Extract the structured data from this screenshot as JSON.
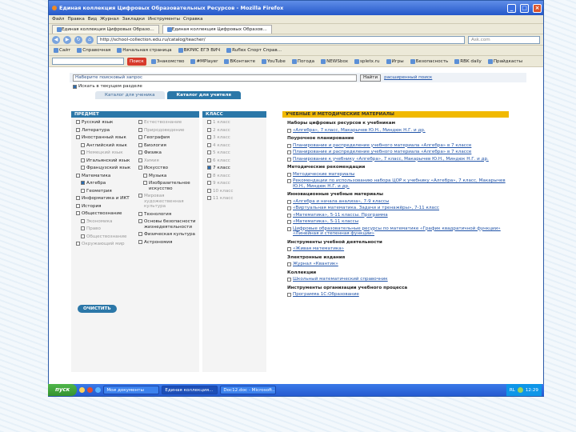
{
  "window": {
    "title": "Единая коллекция Цифровых Образовательных Ресурсов - Mozilla Firefox",
    "controls": [
      "_",
      "□",
      "×"
    ]
  },
  "menu": [
    "Файл",
    "Правка",
    "Вид",
    "Журнал",
    "Закладки",
    "Инструменты",
    "Справка"
  ],
  "tabs": [
    "Единая коллекция Цифровых Образо...",
    "Единая коллекция Цифровых Образов..."
  ],
  "nav": {
    "url": "http://school-collection.edu.ru/catalog/teacher/",
    "search_placeholder": "Ask.com"
  },
  "bookmarks": [
    "Сайт",
    "Справочная",
    "Начальная страница",
    "ВКРИС ЕГЭ ВИЧ",
    "Ruflex Спорт Справ..."
  ],
  "toolbar2": {
    "search_label": "Поиск",
    "items": [
      "Знакомство",
      "#MPlayer",
      "ВКонтакте",
      "YouTube",
      "Погода",
      "NEWSbox",
      "spletx.ru",
      "Игры",
      "Безопасность",
      "RBK daily",
      "Прайдкасты"
    ]
  },
  "page": {
    "search_checkbox": "Искать в текущем разделе",
    "advanced_link": "расширенный поиск",
    "search_button": "Найти",
    "yandex_link": "Наберите поисковый запрос",
    "tabs": [
      "Каталог для ученика",
      "Каталог для учителя"
    ],
    "subject_header": "ПРЕДМЕТ",
    "subjects_col1": [
      {
        "label": "Русский язык",
        "level": 0,
        "checked": false,
        "grey": false
      },
      {
        "label": "Литература",
        "level": 0,
        "checked": false,
        "grey": false
      },
      {
        "label": "Иностранный язык",
        "level": 0,
        "checked": false,
        "grey": false
      },
      {
        "label": "Английский язык",
        "level": 1,
        "checked": false,
        "grey": false
      },
      {
        "label": "Немецкий язык",
        "level": 1,
        "checked": false,
        "grey": true
      },
      {
        "label": "Итальянский язык",
        "level": 1,
        "checked": false,
        "grey": false
      },
      {
        "label": "Французский язык",
        "level": 1,
        "checked": false,
        "grey": false
      },
      {
        "label": "Математика",
        "level": 0,
        "checked": false,
        "grey": false
      },
      {
        "label": "Алгебра",
        "level": 1,
        "checked": true,
        "grey": false
      },
      {
        "label": "Геометрия",
        "level": 1,
        "checked": false,
        "grey": false
      },
      {
        "label": "Информатика и ИКТ",
        "level": 0,
        "checked": false,
        "grey": false
      },
      {
        "label": "История",
        "level": 0,
        "checked": false,
        "grey": false
      },
      {
        "label": "Обществознание",
        "level": 0,
        "checked": false,
        "grey": false
      },
      {
        "label": "Экономика",
        "level": 1,
        "checked": false,
        "grey": true
      },
      {
        "label": "Право",
        "level": 1,
        "checked": false,
        "grey": true
      },
      {
        "label": "Обществознание",
        "level": 1,
        "checked": false,
        "grey": true
      },
      {
        "label": "Окружающий мир",
        "level": 0,
        "checked": false,
        "grey": true
      }
    ],
    "subjects_col2": [
      {
        "label": "Естествознание",
        "level": 0,
        "checked": false,
        "grey": true
      },
      {
        "label": "Природоведение",
        "level": 0,
        "checked": false,
        "grey": true
      },
      {
        "label": "География",
        "level": 0,
        "checked": false,
        "grey": false
      },
      {
        "label": "Биология",
        "level": 0,
        "checked": false,
        "grey": false
      },
      {
        "label": "Физика",
        "level": 0,
        "checked": false,
        "grey": false
      },
      {
        "label": "Химия",
        "level": 0,
        "checked": false,
        "grey": true
      },
      {
        "label": "Искусство",
        "level": 0,
        "checked": false,
        "grey": false
      },
      {
        "label": "Музыка",
        "level": 1,
        "checked": false,
        "grey": false
      },
      {
        "label": "Изобразительное искусство",
        "level": 1,
        "checked": false,
        "grey": false
      },
      {
        "label": "Мировая художественная культура",
        "level": 0,
        "checked": false,
        "grey": true
      },
      {
        "label": "Технология",
        "level": 0,
        "checked": false,
        "grey": false
      },
      {
        "label": "Основы безопасности жизнедеятельности",
        "level": 0,
        "checked": false,
        "grey": false
      },
      {
        "label": "Физическая культура",
        "level": 0,
        "checked": false,
        "grey": false
      },
      {
        "label": "Астрономия",
        "level": 0,
        "checked": false,
        "grey": false
      }
    ],
    "class_header": "КЛАСС",
    "classes": [
      {
        "label": "1 класс",
        "checked": false
      },
      {
        "label": "2 класс",
        "checked": false
      },
      {
        "label": "3 класс",
        "checked": false
      },
      {
        "label": "4 класс",
        "checked": false
      },
      {
        "label": "5 класс",
        "checked": false
      },
      {
        "label": "6 класс",
        "checked": false
      },
      {
        "label": "7 класс",
        "checked": true
      },
      {
        "label": "8 класс",
        "checked": false
      },
      {
        "label": "9 класс",
        "checked": false
      },
      {
        "label": "10 класс",
        "checked": false
      },
      {
        "label": "11 класс",
        "checked": false
      }
    ],
    "clear_button": "ОЧИСТИТЬ",
    "materials_header": "УЧЕБНЫЕ И МЕТОДИЧЕСКИЕ МАТЕРИАЛЫ",
    "sections": [
      {
        "title": "Наборы цифровых ресурсов к учебникам",
        "items": [
          "«Алгебра», 7 класс, Макарычев Ю.Н., Миндюк Н.Г. и др."
        ]
      },
      {
        "title": "Поурочное планирование",
        "items": [
          "Планирование и распределение учебного материала «Алгебра» в 7 классе",
          "Планирование и распределение учебного материала «Алгебра» в 7 классе",
          "Планирование к учебнику «Алгебра», 7 класс, Макарычев Ю.Н., Миндюк Н.Г. и др."
        ]
      },
      {
        "title": "Методические рекомендации",
        "items": [
          "Методические материалы",
          "Рекомендации по использованию набора ЦОР к учебнику «Алгебра», 7 класс, Макарычев Ю.Н., Миндюк Н.Г. и др."
        ]
      },
      {
        "title": "Инновационные учебные материалы",
        "items": [
          "«Алгебра и начала анализа», 7-9 классы",
          "«Виртуальная математика. Задачи и тренажёры», 7-11 класс",
          "«Математика», 5-11 классы. Программа",
          "«Математика», 5-11 классы",
          "Цифровые образовательные ресурсы по математике «График квадратичной функции» «Линейная и степенная функции»"
        ]
      },
      {
        "title": "Инструменты учебной деятельности",
        "items": [
          "«Живая математика»"
        ]
      },
      {
        "title": "Электронные издания",
        "items": [
          "Журнал «Квантик»"
        ]
      },
      {
        "title": "Коллекции",
        "items": [
          "Школьный математический справочник"
        ]
      },
      {
        "title": "Инструменты организации учебного процесса",
        "items": [
          "Программа 1С:Образование"
        ]
      }
    ]
  },
  "taskbar": {
    "start": "пуск",
    "tasks": [
      "Мои документы",
      "Единая коллекция...",
      "Doc12.doc - Microsoft..."
    ],
    "clock": "12:29",
    "lang": "RL"
  }
}
